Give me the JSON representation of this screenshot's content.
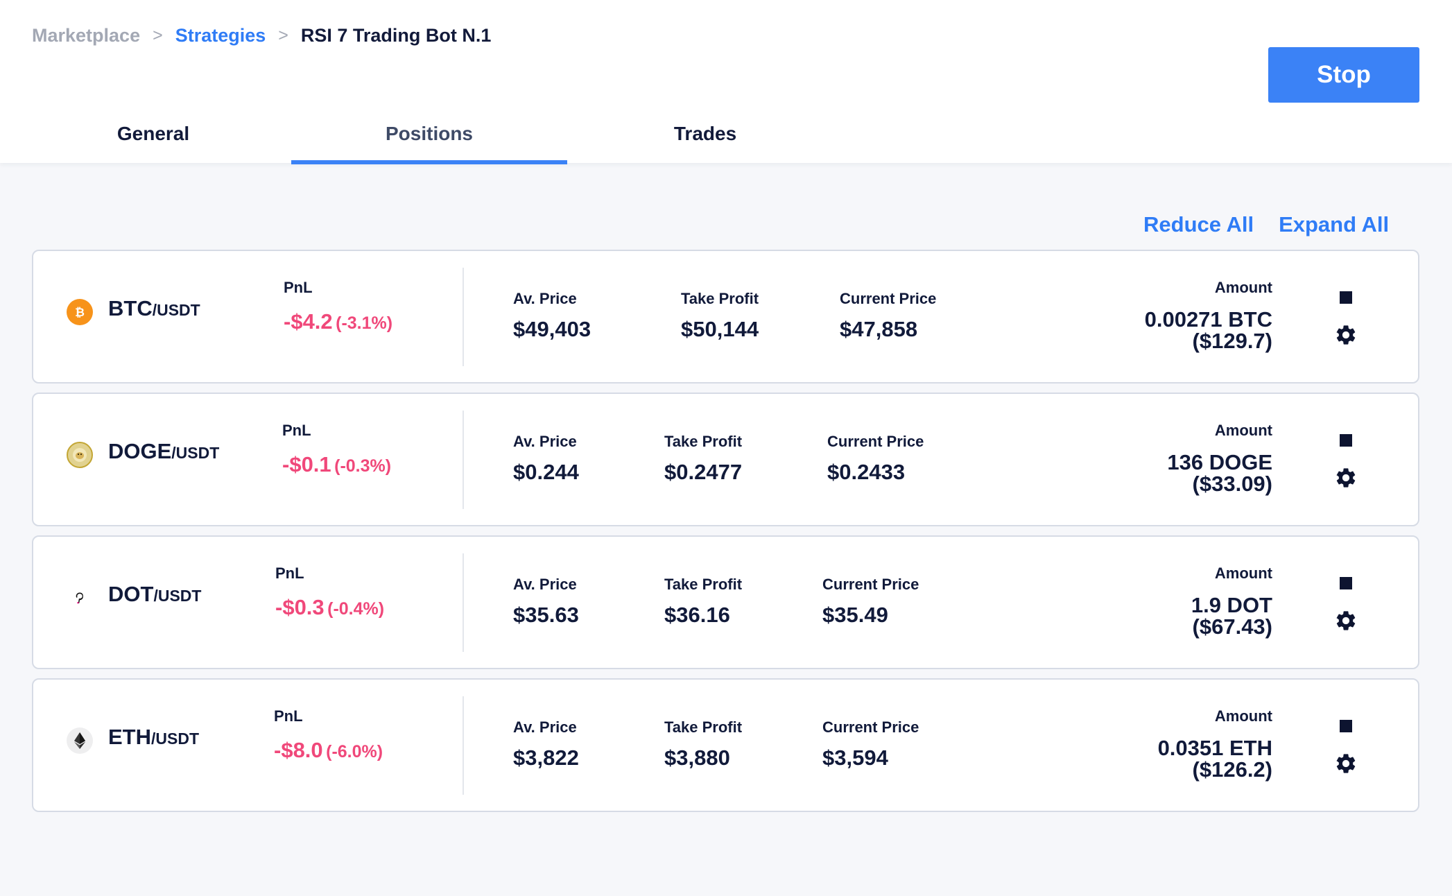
{
  "breadcrumb": {
    "root": "Marketplace",
    "section": "Strategies",
    "current": "RSI 7 Trading Bot N.1",
    "separator": ">"
  },
  "header": {
    "stop_label": "Stop"
  },
  "tabs": [
    {
      "label": "General",
      "active": false
    },
    {
      "label": "Positions",
      "active": true
    },
    {
      "label": "Trades",
      "active": false
    }
  ],
  "actions": {
    "reduce_all": "Reduce All",
    "expand_all": "Expand All"
  },
  "labels": {
    "pnl": "PnL",
    "av_price": "Av. Price",
    "take_profit": "Take Profit",
    "current_price": "Current Price",
    "amount": "Amount"
  },
  "positions": [
    {
      "base": "BTC",
      "quote": "/USDT",
      "icon": "bitcoin-icon",
      "color": "#f7931a",
      "pnl": "-$4.2",
      "pnl_pct": "(-3.1%)",
      "av_price": "$49,403",
      "take_profit": "$50,144",
      "current_price": "$47,858",
      "amount_qty": "0.00271 BTC",
      "amount_usd": "($129.7)"
    },
    {
      "base": "DOGE",
      "quote": "/USDT",
      "icon": "dogecoin-icon",
      "color": "#c3a634",
      "pnl": "-$0.1",
      "pnl_pct": "(-0.3%)",
      "av_price": "$0.244",
      "take_profit": "$0.2477",
      "current_price": "$0.2433",
      "amount_qty": "136 DOGE",
      "amount_usd": "($33.09)"
    },
    {
      "base": "DOT",
      "quote": "/USDT",
      "icon": "polkadot-icon",
      "color": "#e6007a",
      "pnl": "-$0.3",
      "pnl_pct": "(-0.4%)",
      "av_price": "$35.63",
      "take_profit": "$36.16",
      "current_price": "$35.49",
      "amount_qty": "1.9 DOT",
      "amount_usd": "($67.43)"
    },
    {
      "base": "ETH",
      "quote": "/USDT",
      "icon": "ethereum-icon",
      "color": "#3c3c3d",
      "pnl": "-$8.0",
      "pnl_pct": "(-6.0%)",
      "av_price": "$3,822",
      "take_profit": "$3,880",
      "current_price": "$3,594",
      "amount_qty": "0.0351 ETH",
      "amount_usd": "($126.2)"
    }
  ],
  "colors": {
    "accent": "#3b82f6",
    "negative": "#f0487a",
    "text": "#111a3a"
  }
}
